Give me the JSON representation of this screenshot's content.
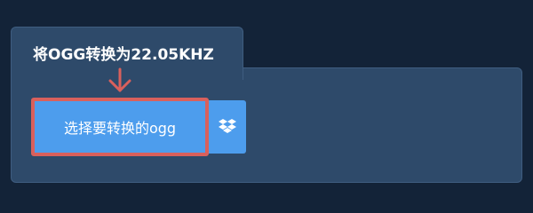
{
  "header": {
    "title": "将OGG转换为22.05KHZ"
  },
  "upload": {
    "select_label": "选择要转换的ogg",
    "dropbox_icon": "dropbox-icon",
    "arrow_icon": "arrow-down-icon"
  },
  "colors": {
    "background": "#132338",
    "panel": "#2e4a6a",
    "button": "#4d9ded",
    "highlight": "#d9605c"
  }
}
